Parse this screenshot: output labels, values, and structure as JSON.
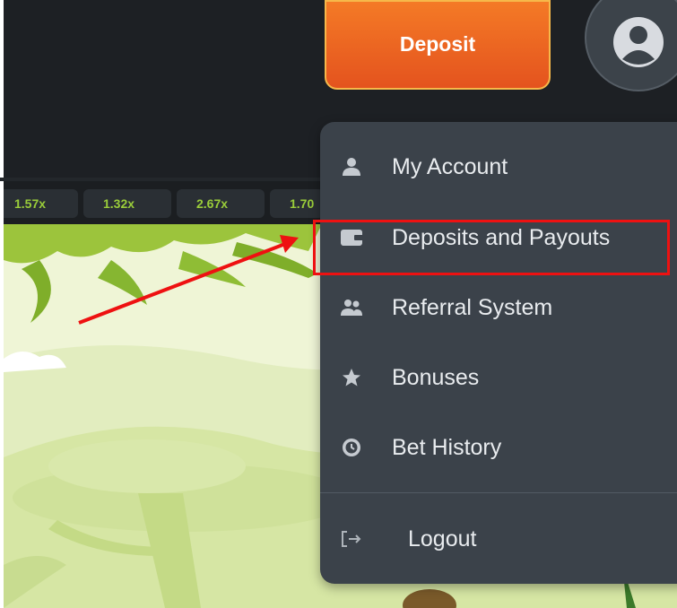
{
  "header": {
    "deposit_label": "Deposit",
    "accent_color": "#f06a22"
  },
  "multipliers": [
    "1.57x",
    "1.32x",
    "2.67x",
    "1.70"
  ],
  "menu": {
    "items": [
      {
        "label": "My Account",
        "icon": "user-icon"
      },
      {
        "label": "Deposits and Payouts",
        "icon": "wallet-icon"
      },
      {
        "label": "Referral System",
        "icon": "users-icon"
      },
      {
        "label": "Bonuses",
        "icon": "star-icon"
      },
      {
        "label": "Bet History",
        "icon": "history-icon"
      }
    ],
    "logout_label": "Logout",
    "logout_icon": "logout-icon"
  },
  "annotation": {
    "highlight_color": "#ee1111"
  }
}
